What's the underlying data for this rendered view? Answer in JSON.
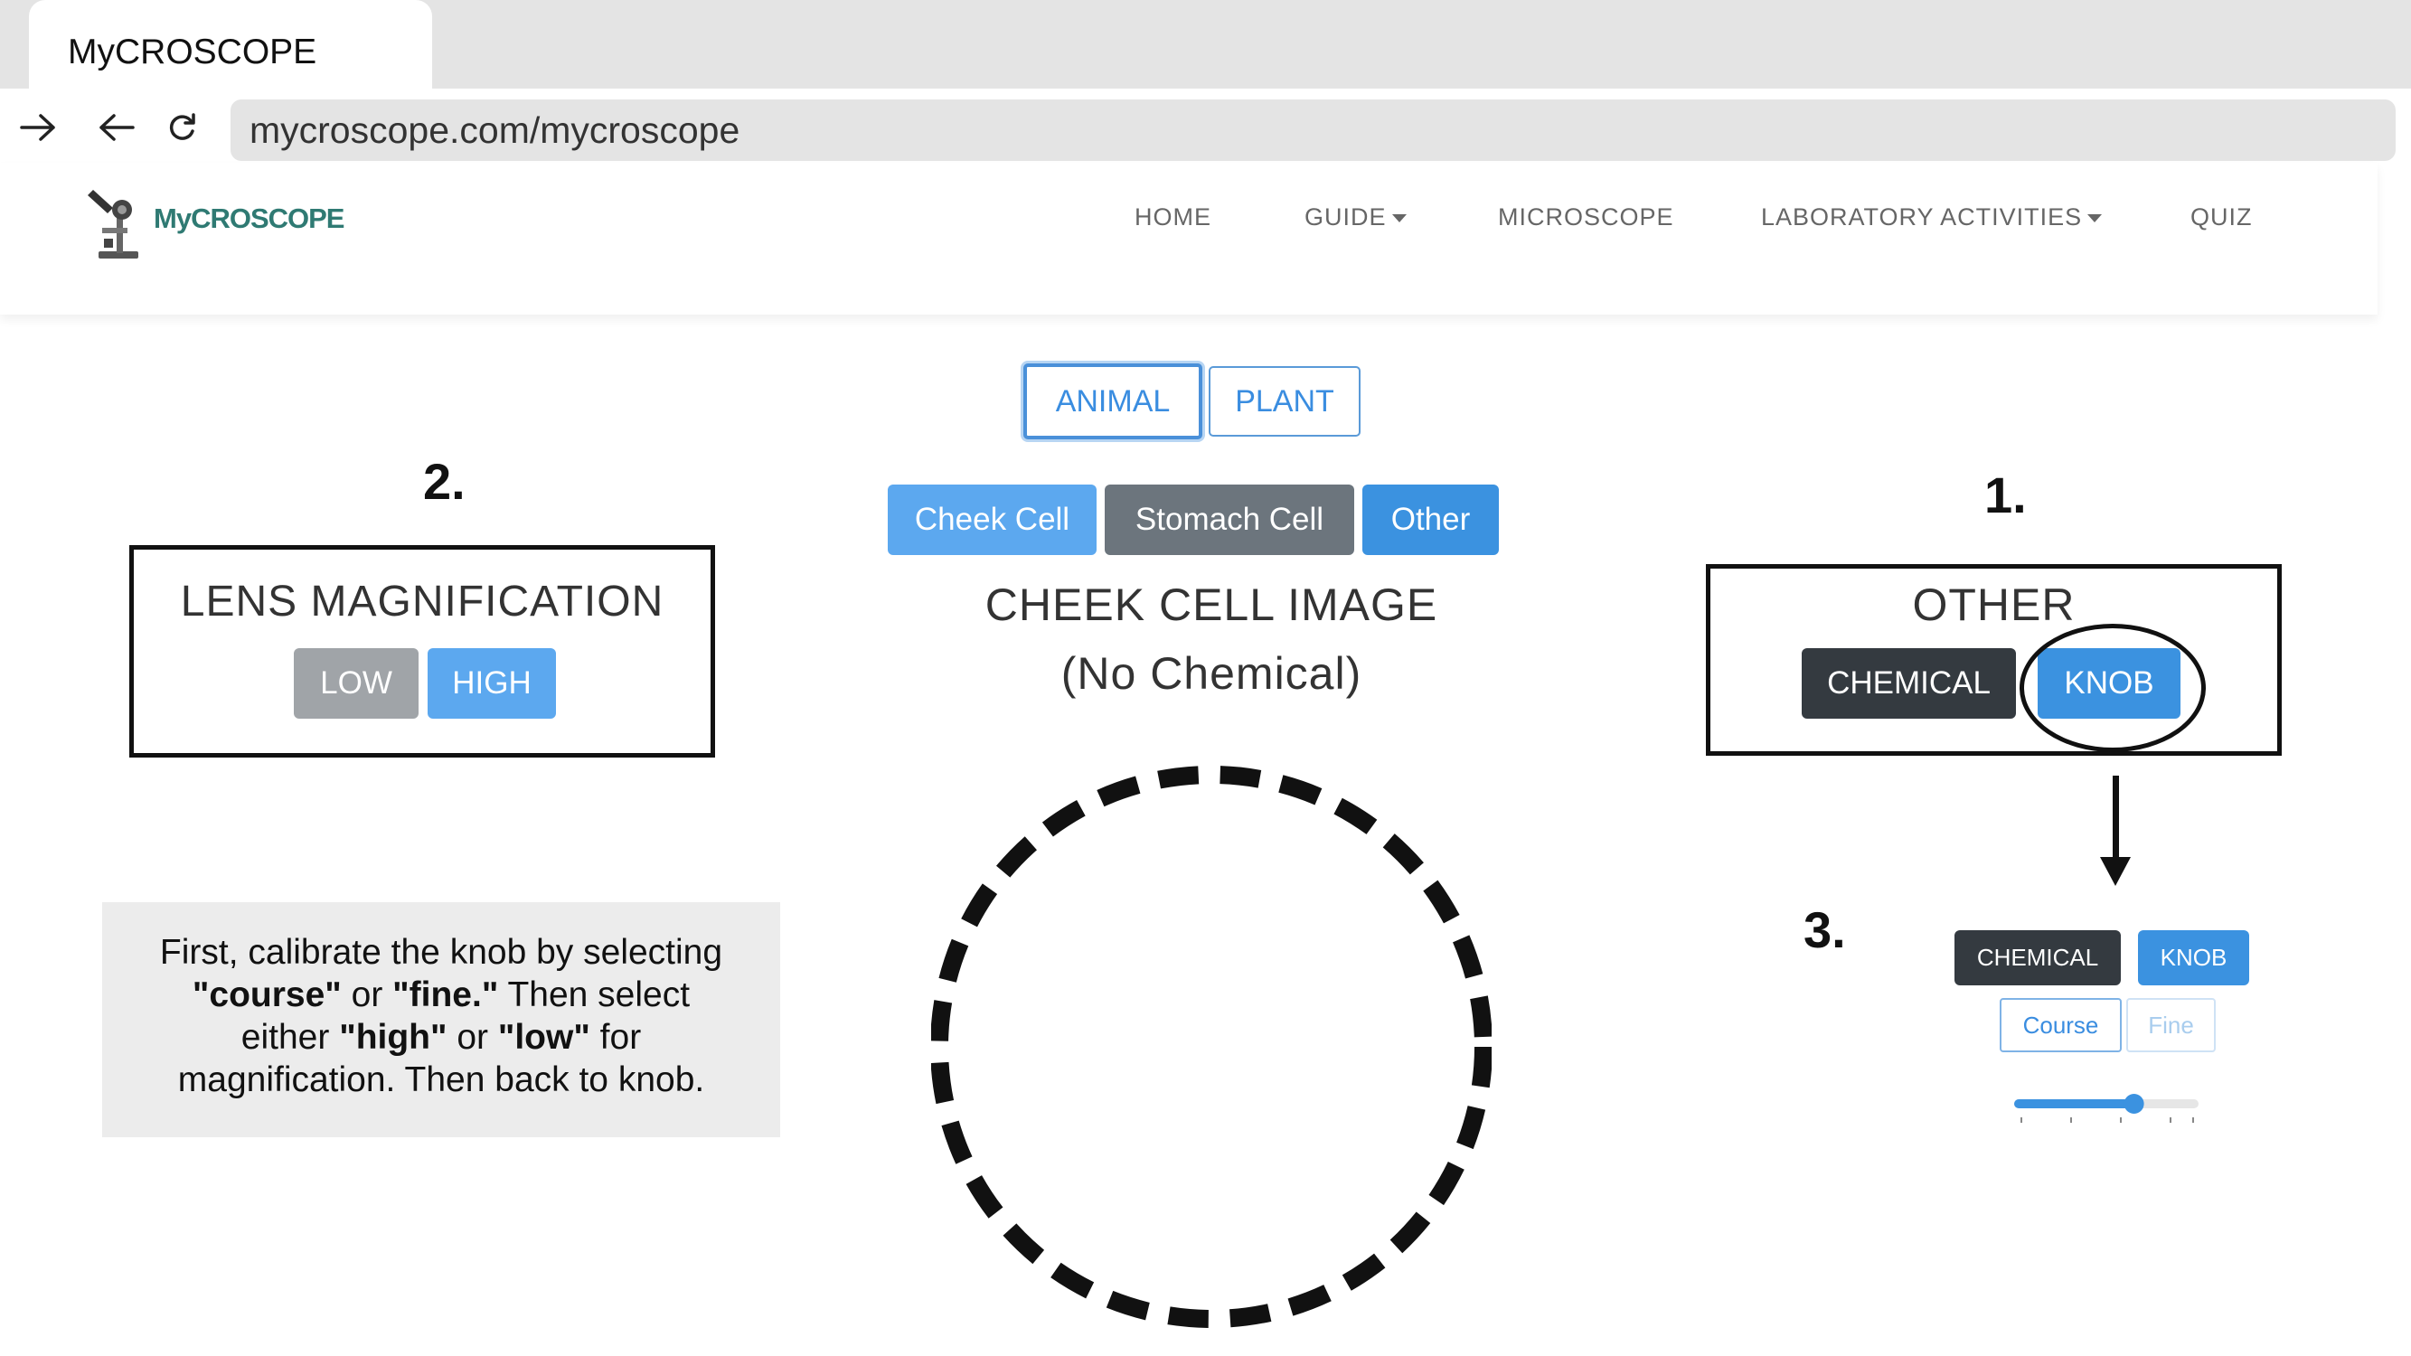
{
  "browser": {
    "tab_title": "MyCROSCOPE",
    "url": "mycroscope.com/mycroscope"
  },
  "site": {
    "logo_text": "MyCROSCOPE",
    "nav": [
      {
        "label": "HOME"
      },
      {
        "label": "GUIDE",
        "dropdown": true
      },
      {
        "label": "MICROSCOPE"
      },
      {
        "label": "LABORATORY ACTIVITIES",
        "dropdown": true
      },
      {
        "label": "QUIZ"
      }
    ]
  },
  "specimen_toggle": {
    "animal": "ANIMAL",
    "plant": "PLANT",
    "selected": "ANIMAL"
  },
  "cell_buttons": {
    "cheek": "Cheek Cell",
    "stomach": "Stomach Cell",
    "other": "Other"
  },
  "image": {
    "title": "CHEEK CELL IMAGE",
    "subtitle": "(No Chemical)"
  },
  "lens": {
    "step": "2.",
    "title": "LENS MAGNIFICATION",
    "low": "LOW",
    "high": "HIGH"
  },
  "instructions": {
    "p1": "First, calibrate the knob by selecting",
    "b1": "\"course\"",
    "p2": " or ",
    "b2": "\"fine.\"",
    "p3": " Then select",
    "p4": "either ",
    "b3": "\"high\"",
    "p5": " or ",
    "b4": "\"low\"",
    "p6": " for",
    "p7": "magnification. Then back to knob."
  },
  "other_panel": {
    "step": "1.",
    "title": "OTHER",
    "chemical": "CHEMICAL",
    "knob": "KNOB"
  },
  "knob_panel": {
    "step": "3.",
    "chemical": "CHEMICAL",
    "knob": "KNOB",
    "course": "Course",
    "fine": "Fine",
    "slider_value": 0.65
  },
  "colors": {
    "primary": "#3b92e0",
    "secondary": "#6c757d",
    "dark": "#343a40",
    "logo": "#2f7a73"
  }
}
